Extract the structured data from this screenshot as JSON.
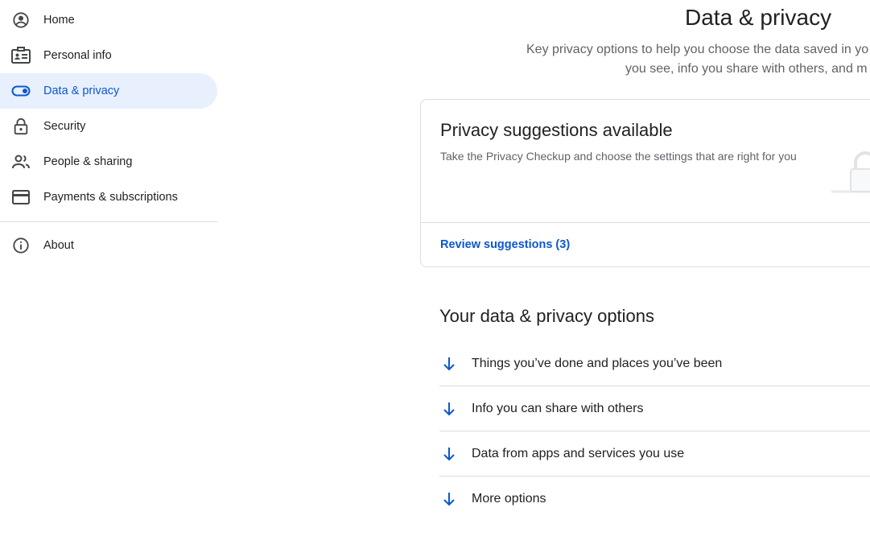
{
  "sidebar": {
    "items": [
      {
        "label": "Home",
        "icon": "account-circle-icon"
      },
      {
        "label": "Personal info",
        "icon": "id-card-icon"
      },
      {
        "label": "Data & privacy",
        "icon": "toggle-icon",
        "active": true
      },
      {
        "label": "Security",
        "icon": "lock-icon"
      },
      {
        "label": "People & sharing",
        "icon": "people-icon"
      },
      {
        "label": "Payments & subscriptions",
        "icon": "credit-card-icon"
      },
      {
        "label": "About",
        "icon": "info-icon"
      }
    ]
  },
  "header": {
    "title": "Data & privacy",
    "subtitle_line1": "Key privacy options to help you choose the data saved in yo",
    "subtitle_line2": "you see, info you share with others, and m"
  },
  "suggestion_card": {
    "title": "Privacy suggestions available",
    "description": "Take the Privacy Checkup and choose the settings that are right for you",
    "link": "Review suggestions (3)",
    "illustration": "lock-illustration"
  },
  "options_section": {
    "title": "Your data & privacy options",
    "items": [
      {
        "label": "Things you’ve done and places you’ve been",
        "icon": "arrow-down-icon"
      },
      {
        "label": "Info you can share with others",
        "icon": "arrow-down-icon"
      },
      {
        "label": "Data from apps and services you use",
        "icon": "arrow-down-icon"
      },
      {
        "label": "More options",
        "icon": "arrow-down-icon"
      }
    ]
  },
  "colors": {
    "accent": "#0b57d0",
    "active_bg": "#e8f0fe",
    "divider": "#dadce0",
    "secondary_text": "#5f6368"
  }
}
